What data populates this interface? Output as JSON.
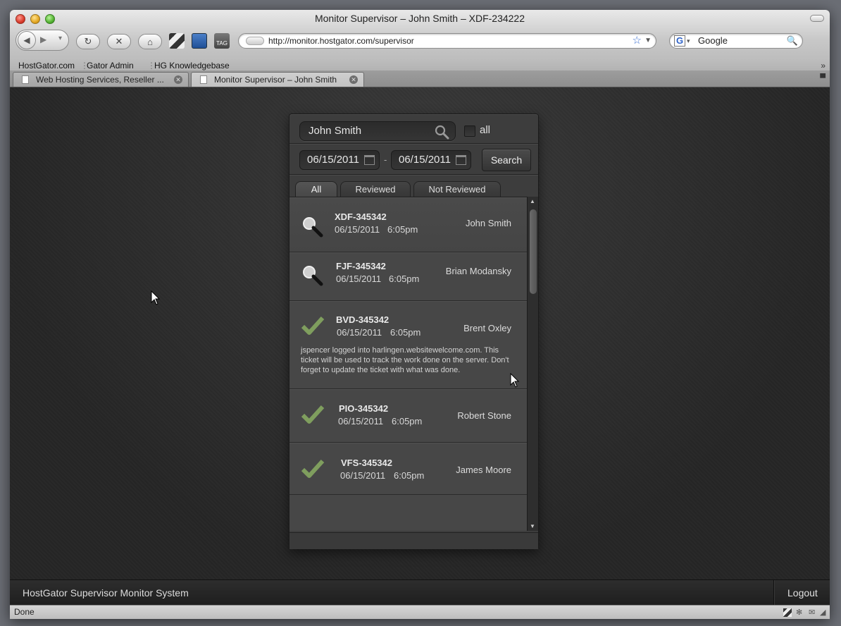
{
  "browser": {
    "window_title": "Monitor Supervisor – John Smith – XDF-234222",
    "url": "http://monitor.hostgator.com/supervisor",
    "search_engine_value": "Google",
    "bookmarks": [
      "HostGator.com",
      "Gator Admin",
      "HG Knowledgebase"
    ],
    "tabs": [
      {
        "label": "Web Hosting Services, Reseller ..."
      },
      {
        "label": "Monitor Supervisor – John Smith"
      }
    ],
    "toolbar_icon_tag": "TAG",
    "status": "Done"
  },
  "panel": {
    "search_value": "John Smith",
    "all_label": "all",
    "date_from": "06/15/2011",
    "date_to": "06/15/2011",
    "date_separator": "-",
    "search_button": "Search",
    "filter_tabs": [
      "All",
      "Reviewed",
      "Not Reviewed"
    ],
    "tickets": [
      {
        "id": "XDF-345342",
        "date": "06/15/2011",
        "time": "6:05pm",
        "user": "John Smith",
        "status_icon": "magnifier-icon"
      },
      {
        "id": "FJF-345342",
        "date": "06/15/2011",
        "time": "6:05pm",
        "user": "Brian Modansky",
        "status_icon": "magnifier-icon"
      },
      {
        "id": "BVD-345342",
        "date": "06/15/2011",
        "time": "6:05pm",
        "user": "Brent Oxley",
        "status_icon": "checkmark-icon",
        "description": "jspencer logged into harlingen.websitewelcome.com. This ticket will be used to track the work done on the server. Don't forget to update the ticket with what was done."
      },
      {
        "id": "PIO-345342",
        "date": "06/15/2011",
        "time": "6:05pm",
        "user": "Robert Stone",
        "status_icon": "checkmark-icon"
      },
      {
        "id": "VFS-345342",
        "date": "06/15/2011",
        "time": "6:05pm",
        "user": "James Moore",
        "status_icon": "checkmark-icon"
      }
    ]
  },
  "footer": {
    "brand": "HostGator Supervisor Monitor System",
    "logout": "Logout"
  },
  "colors": {
    "checkmark": "#7f9e5e",
    "panel_bg": "#3d3d3d",
    "row_bg": "#474747"
  }
}
